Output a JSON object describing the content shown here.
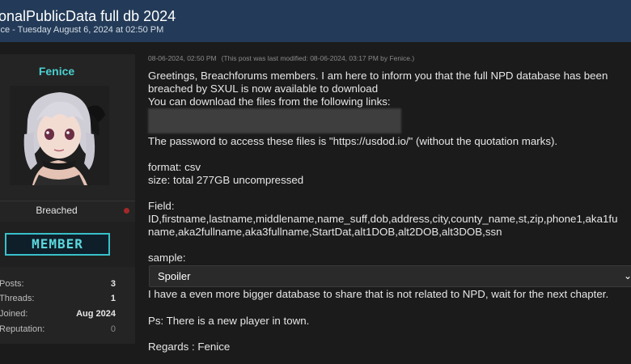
{
  "thread": {
    "title": "onalPublicData full db 2024",
    "subtitle": "ice - Tuesday August 6, 2024 at 02:50 PM"
  },
  "user": {
    "name": "Fenice",
    "group": "Breached",
    "badge": "MEMBER",
    "stats": [
      {
        "label": "Posts:",
        "value": "3"
      },
      {
        "label": "Threads:",
        "value": "1"
      },
      {
        "label": "Joined:",
        "value": "Aug 2024"
      },
      {
        "label": "Reputation:",
        "value": "0"
      }
    ]
  },
  "post": {
    "date": "08-06-2024, 02:50 PM",
    "modified": "(This post was last modified: 08-06-2024, 03:17 PM by Fenice.)",
    "lines": [
      "Greetings, Breachforums members. I am here to inform you that the full NPD database has been",
      "breached by SXUL is now available to download",
      "You can download the files from the following links:",
      "The password to access these files is \"https://usdod.io/\" (without the quotation marks).",
      "format: csv",
      "size: total 277GB uncompressed",
      "Field:",
      "ID,firstname,lastname,middlename,name_suff,dob,address,city,county_name,st,zip,phone1,aka1fu",
      "name,aka2fullname,aka3fullname,StartDat,alt1DOB,alt2DOB,alt3DOB,ssn",
      "sample:",
      "I have a even more bigger database to share that is not related to NPD, wait for the next chapter.",
      "Ps: There is a new player in town.",
      "Regards : Fenice"
    ],
    "spoiler_label": "Spoiler"
  },
  "colors": {
    "header_bg": "#233b58",
    "username": "#4cd0d0",
    "badge_border": "#38c1c9",
    "status_dot": "#a32828"
  },
  "icons": {
    "spoiler_toggle": "chevron-down-icon",
    "status": "status-dot-icon"
  }
}
